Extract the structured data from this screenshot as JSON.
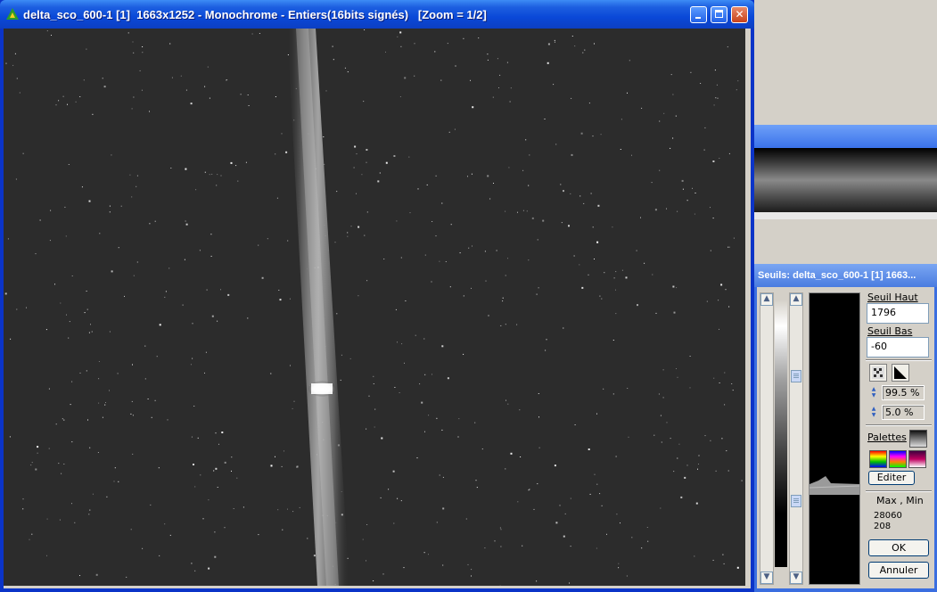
{
  "window": {
    "title": "delta_sco_600-1 [1]  1663x1252 - Monochrome - Entiers(16bits signés)   [Zoom = 1/2]",
    "minimize": "minimize-icon",
    "maximize": "maximize-icon",
    "close": "close-icon",
    "close_glyph": "✕"
  },
  "image": {
    "description_icon": "star-field-spectrum-image"
  },
  "seuils": {
    "title": "Seuils: delta_sco_600-1 [1]  1663...",
    "seuil_haut_label": "Seuil Haut",
    "seuil_haut_value": "1796",
    "seuil_bas_label": "Seuil Bas",
    "seuil_bas_value": "-60",
    "pct_high": "99.5 %",
    "pct_low": "5.0 %",
    "palettes_label": "Palettes",
    "editer_label": "Editer",
    "maxmin_label": "Max , Min",
    "max_value": "28060",
    "min_value": "208",
    "ok_label": "OK",
    "annuler_label": "Annuler"
  },
  "colors": {
    "title_blue": "#0a48d8",
    "panel_gray": "#d4d0c8",
    "image_bg": "#2c2c2c"
  }
}
